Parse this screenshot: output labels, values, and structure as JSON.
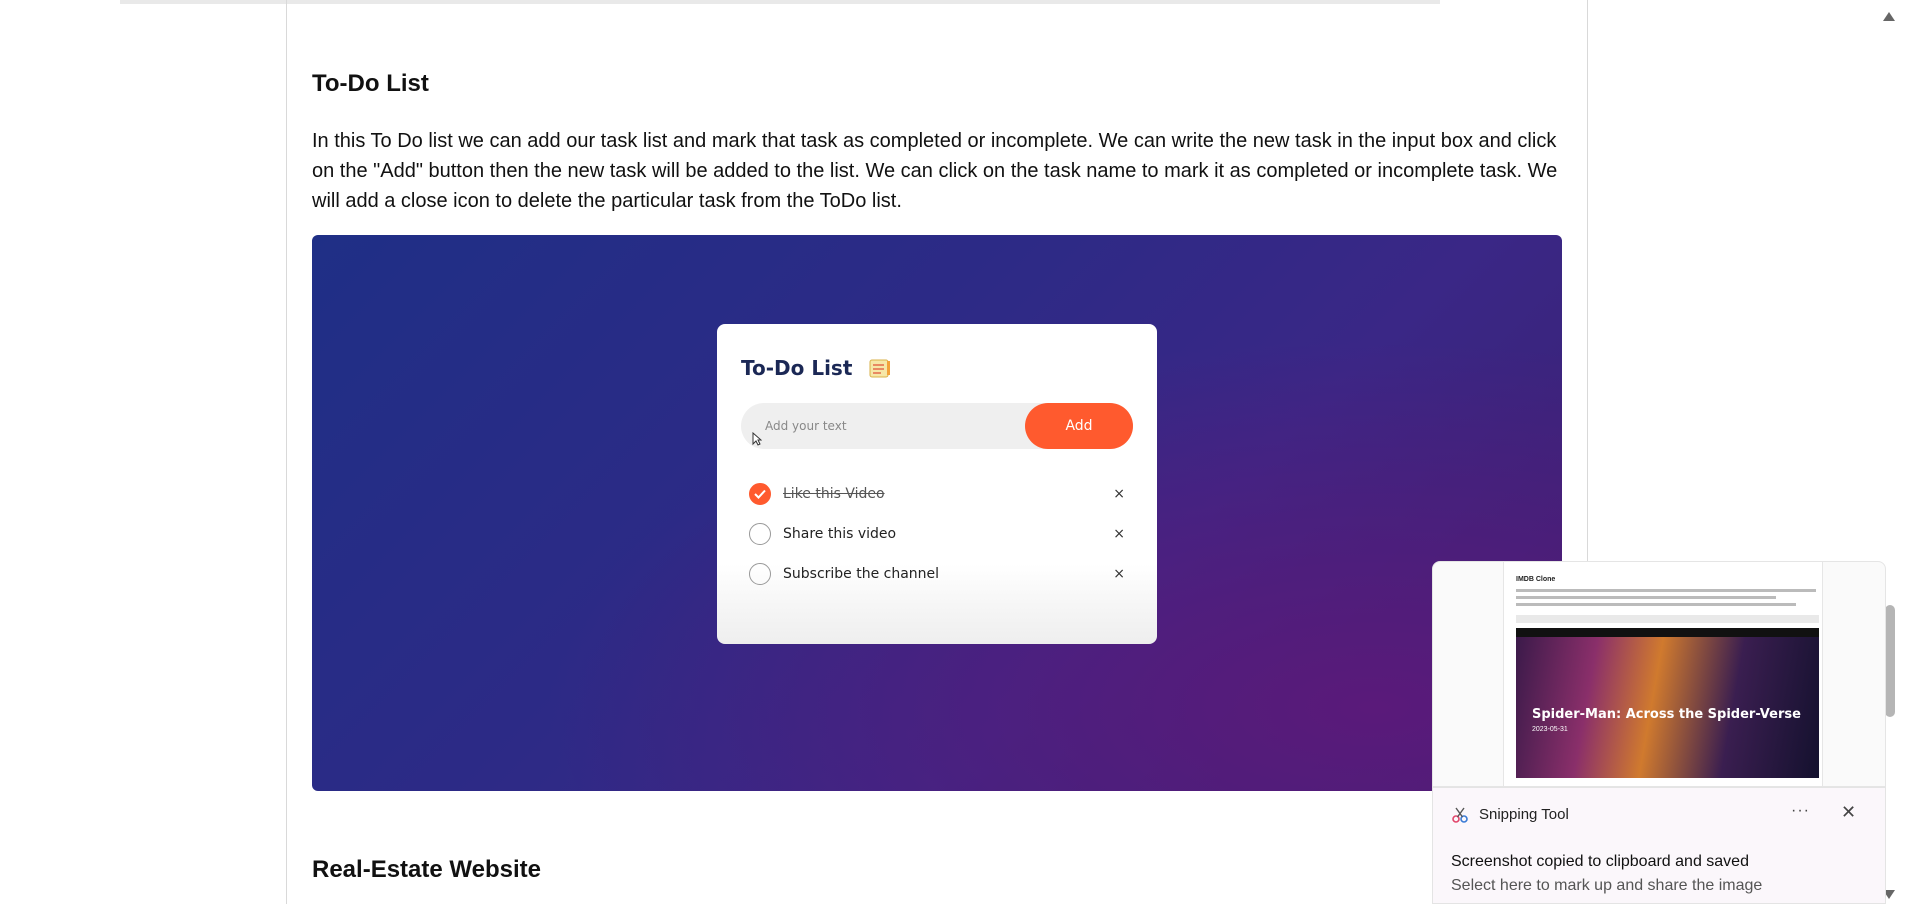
{
  "section": {
    "heading": "To-Do List",
    "paragraph": "In this To Do list we can add our task list and mark that task as completed or incomplete. We can write the new task in the input box and click on the \"Add\" button then the new task will be added to the list. We can click on the task name to mark it as completed or incomplete task. We will add a close icon to delete the particular task from the ToDo list."
  },
  "todo_app": {
    "title": "To-Do List",
    "input_placeholder": "Add your text",
    "add_label": "Add",
    "tasks": [
      {
        "text": "Like this Video",
        "completed": true
      },
      {
        "text": "Share this video",
        "completed": false
      },
      {
        "text": "Subscribe the channel",
        "completed": false
      }
    ],
    "accent_color": "#ff5a2e",
    "title_color": "#1b2855"
  },
  "next_section": {
    "heading": "Real-Estate Website"
  },
  "preview_thumbnail": {
    "page_title": "IMDB Clone",
    "poster_title": "Spider-Man: Across the Spider-Verse",
    "poster_date": "2023-05-31"
  },
  "toast": {
    "app_name": "Snipping Tool",
    "message": "Screenshot copied to clipboard and saved",
    "sub_message": "Select here to mark up and share the image",
    "more_label": "···",
    "close_label": "✕"
  },
  "icons": {
    "close": "×",
    "check": "check-icon"
  }
}
